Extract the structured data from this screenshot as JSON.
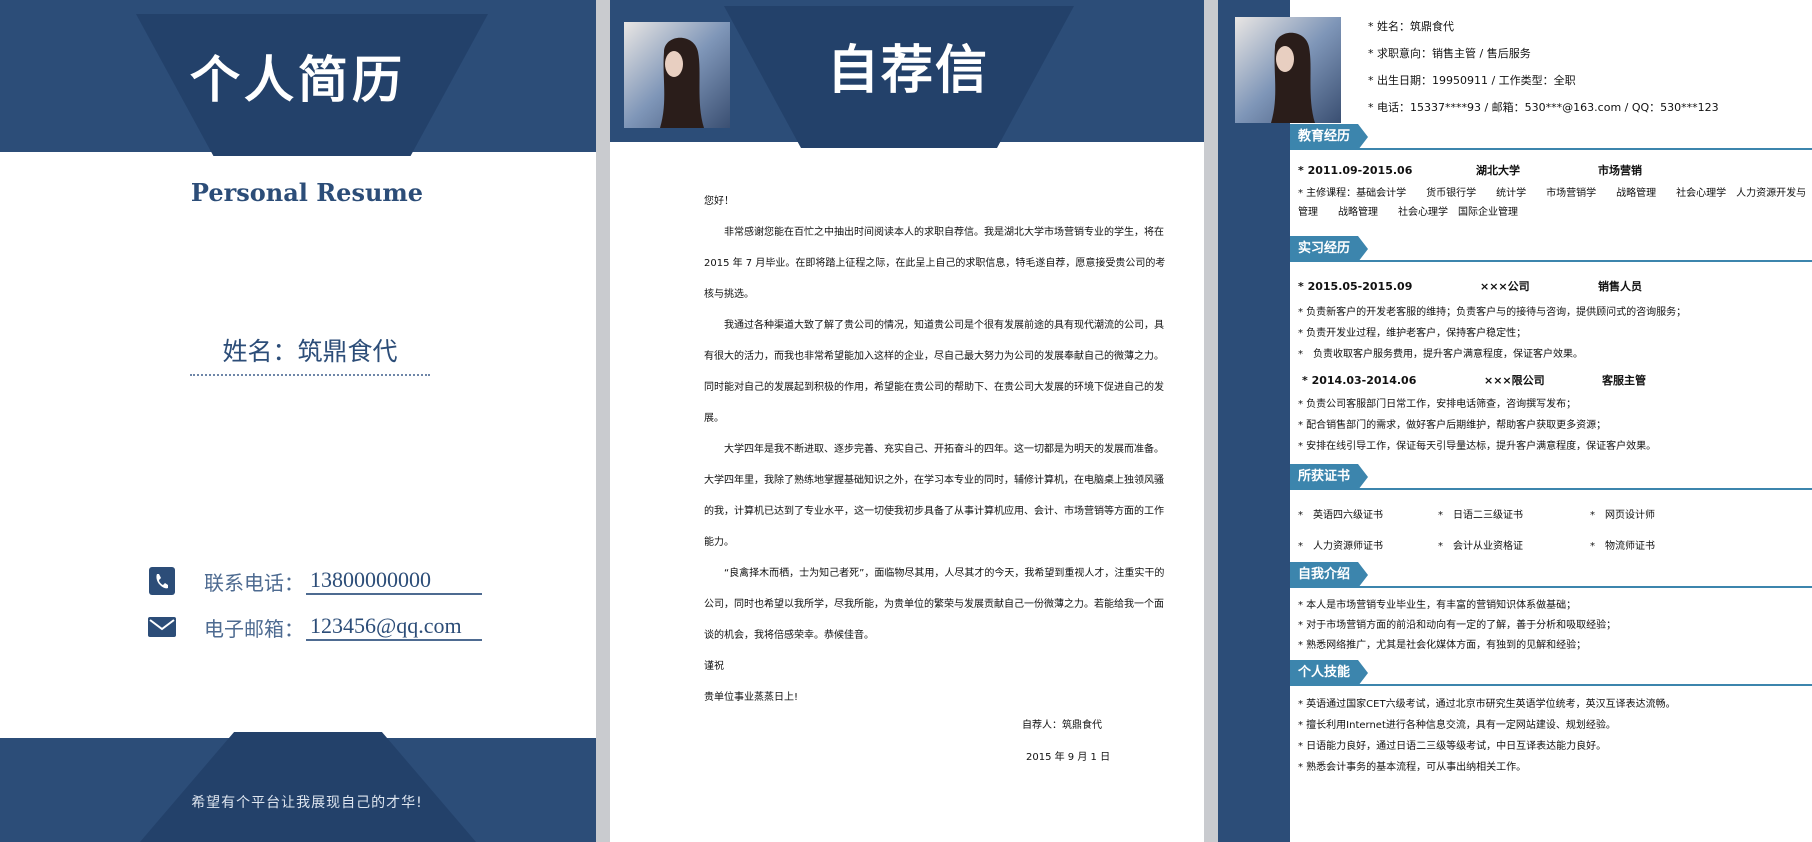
{
  "cover": {
    "title": "个人简历",
    "subtitle": "Personal Resume",
    "name": "姓名：筑鼎食代",
    "phone_label": "联系电话：",
    "phone": "13800000000",
    "email_label": "电子邮箱：",
    "email": "123456@qq.com",
    "slogan": "希望有个平台让我展现自己的才华!"
  },
  "letter": {
    "title": "自荐信",
    "greeting": "您好！",
    "paragraphs": [
      "非常感谢您能在百忙之中抽出时间阅读本人的求职自荐信。我是湖北大学市场营销专业的学生，将在 2015 年 7 月毕业。在即将踏上征程之际，在此呈上自己的求职信息，特毛遂自荐，愿意接受贵公司的考核与挑选。",
      "我通过各种渠道大致了解了贵公司的情况，知道贵公司是个很有发展前途的具有现代潮流的公司，具有很大的活力，而我也非常希望能加入这样的企业，尽自己最大努力为公司的发展奉献自己的微薄之力。同时能对自己的发展起到积极的作用，希望能在贵公司的帮助下、在贵公司大发展的环境下促进自己的发展。",
      "大学四年是我不断进取、逐步完善、充实自己、开拓奋斗的四年。这一切都是为明天的发展而准备。大学四年里，我除了熟练地掌握基础知识之外，在学习本专业的同时，辅修计算机，在电脑桌上独领风骚的我，计算机已达到了专业水平，这一切使我初步具备了从事计算机应用、会计、市场营销等方面的工作能力。",
      "“良禽择木而栖，士为知己者死”，面临物尽其用，人尽其才的今天，我希望到重视人才，注重实干的公司，同时也希望以我所学，尽我所能，为贵单位的繁荣与发展贡献自己一份微薄之力。若能给我一个面谈的机会，我将倍感荣幸。恭候佳音。"
    ],
    "closing1": "谨祝",
    "closing2": "贵单位事业蒸蒸日上!",
    "signer": "自荐人：筑鼎食代",
    "date": "2015 年 9 月 1 日"
  },
  "resume": {
    "info": [
      "* 姓名：筑鼎食代",
      "* 求职意向：销售主管 / 售后服务",
      "* 出生日期：19950911 / 工作类型：全职",
      "* 电话：15337****93 / 邮箱：530***@163.com / QQ：530***123"
    ],
    "edu_title": "教育经历",
    "edu_period": "* 2011.09-2015.06",
    "edu_school": "湖北大学",
    "edu_major": "市场营销",
    "edu_courses": "* 主修课程：基础会计学　　货币银行学　　统计学　　市场营销学　　战略管理　　社会心理学　人力资源开发与管理　　战略管理　　社会心理学　国际企业管理",
    "intern_title": "实习经历",
    "job1_period": "* 2015.05-2015.09",
    "job1_company": "×××公司",
    "job1_role": "销售人员",
    "job1_items": [
      "* 负责新客户的开发老客服的维持；负责客户与的接待与咨询，提供顾问式的咨询服务；",
      "* 负责开发业过程，维护老客户，保持客户稳定性；",
      "*　负责收取客户服务费用，提升客户满意程度，保证客户效果。"
    ],
    "job2_period": "* 2014.03-2014.06",
    "job2_company": "×××限公司",
    "job2_role": "客服主管",
    "job2_items": [
      "* 负责公司客服部门日常工作，安排电话筛查，咨询撰写发布；",
      "* 配合销售部门的需求，做好客户后期维护，帮助客户获取更多资源；",
      "* 安排在线引导工作，保证每天引导量达标，提升客户满意程度，保证客户效果。"
    ],
    "cert_title": "所获证书",
    "certs": [
      "*　英语四六级证书",
      "*　日语二三级证书",
      "*　网页设计师",
      "*　人力资源师证书",
      "*　会计从业资格证",
      "*　物流师证书"
    ],
    "self_title": "自我介绍",
    "self_items": [
      "* 本人是市场营销专业毕业生，有丰富的营销知识体系做基础；",
      "* 对于市场营销方面的前沿和动向有一定的了解，善于分析和吸取经验；",
      "* 熟悉网络推广，尤其是社会化媒体方面，有独到的见解和经验；"
    ],
    "skill_title": "个人技能",
    "skill_items": [
      "* 英语通过国家CET六级考试，通过北京市研究生英语学位统考，英汉互译表达流畅。",
      "* 擅长利用Internet进行各种信息交流，具有一定网站建设、规划经验。",
      "* 日语能力良好，通过日语二三级等级考试，中日互译表达能力良好。",
      "* 熟悉会计事务的基本流程，可从事出纳相关工作。"
    ]
  },
  "colors": {
    "navy": "#2c4d78",
    "navy_dark": "#23416a",
    "section_blue": "#3c85ad"
  }
}
